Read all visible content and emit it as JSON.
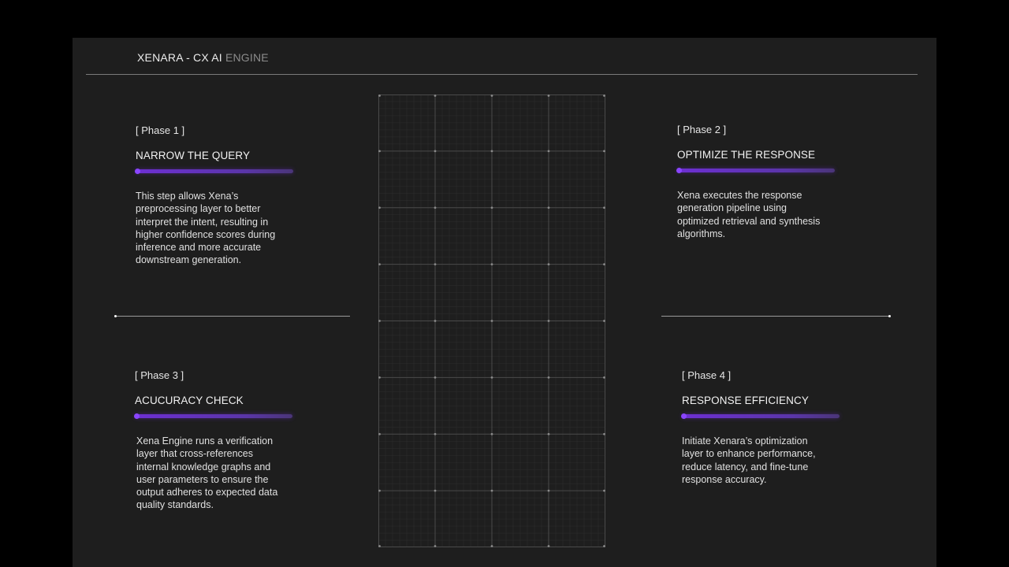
{
  "header": {
    "brand_main": "XENARA - CX AI",
    "brand_sub": "ENGINE"
  },
  "phases": [
    {
      "tag": "[ Phase 1 ]",
      "title": "NARROW THE QUERY",
      "body": "This step allows Xena’s preprocessing layer to better interpret the intent, resulting in higher confidence scores during inference and more accurate downstream generation.",
      "progress": 1.0
    },
    {
      "tag": "[ Phase 2 ]",
      "title": "OPTIMIZE THE RESPONSE",
      "body": "Xena executes the response generation pipeline using optimized retrieval and synthesis algorithms.",
      "progress": 1.0
    },
    {
      "tag": "[ Phase 3 ]",
      "title": "ACUCURACY CHECK",
      "body": "Xena Engine runs a verification layer that cross-references internal knowledge graphs and user parameters to ensure the output adheres to expected data quality standards.",
      "progress": 1.0
    },
    {
      "tag": "[ Phase 4 ]",
      "title": "RESPONSE EFFICIENCY",
      "body": "Initiate Xenara’s optimization layer to enhance performance, reduce latency, and fine-tune response accuracy.",
      "progress": 1.0
    }
  ],
  "colors": {
    "accent": "#6d2fd3",
    "background": "#1e1e1e",
    "outer": "#000000",
    "text": "#e6e6e6"
  }
}
